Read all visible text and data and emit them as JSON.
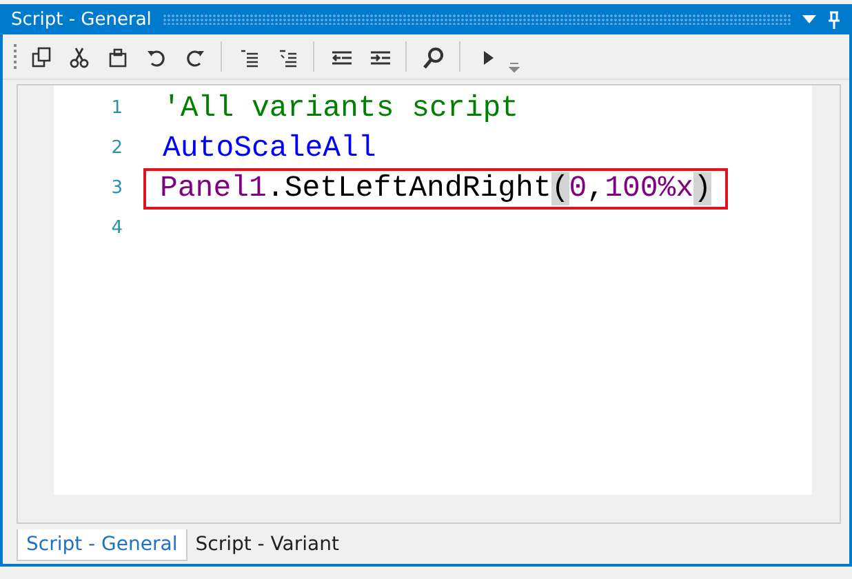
{
  "window": {
    "title": "Script - General"
  },
  "toolbar": [
    {
      "kind": "grip"
    },
    {
      "kind": "copy"
    },
    {
      "kind": "cut"
    },
    {
      "kind": "paste"
    },
    {
      "kind": "undo"
    },
    {
      "kind": "redo"
    },
    {
      "kind": "separator"
    },
    {
      "kind": "comment"
    },
    {
      "kind": "uncomment"
    },
    {
      "kind": "separator"
    },
    {
      "kind": "outdent"
    },
    {
      "kind": "indent"
    },
    {
      "kind": "separator"
    },
    {
      "kind": "search"
    },
    {
      "kind": "separator"
    },
    {
      "kind": "run"
    },
    {
      "kind": "overflow"
    }
  ],
  "editor": {
    "lines": [
      {
        "number": "1",
        "current": false,
        "boxed": false,
        "tokens": [
          {
            "kind": "comment",
            "text": "'All variants script"
          }
        ]
      },
      {
        "number": "2",
        "current": false,
        "boxed": false,
        "tokens": [
          {
            "kind": "keyword",
            "text": "AutoScaleAll"
          }
        ]
      },
      {
        "number": "3",
        "current": true,
        "boxed": true,
        "tokens": [
          {
            "kind": "identifier",
            "text": "Panel1"
          },
          {
            "kind": "plain",
            "text": ".SetLeftAndRight"
          },
          {
            "kind": "bracket",
            "text": "(",
            "matched": true
          },
          {
            "kind": "number",
            "text": "0"
          },
          {
            "kind": "plain",
            "text": ","
          },
          {
            "kind": "number",
            "text": "100%x"
          },
          {
            "kind": "bracket",
            "text": ")",
            "matched": true
          }
        ]
      },
      {
        "number": "4",
        "current": false,
        "boxed": false
      }
    ]
  },
  "tabs": [
    {
      "label": "Script - General",
      "selected": true
    },
    {
      "label": "Script - Variant",
      "selected": false
    }
  ]
}
